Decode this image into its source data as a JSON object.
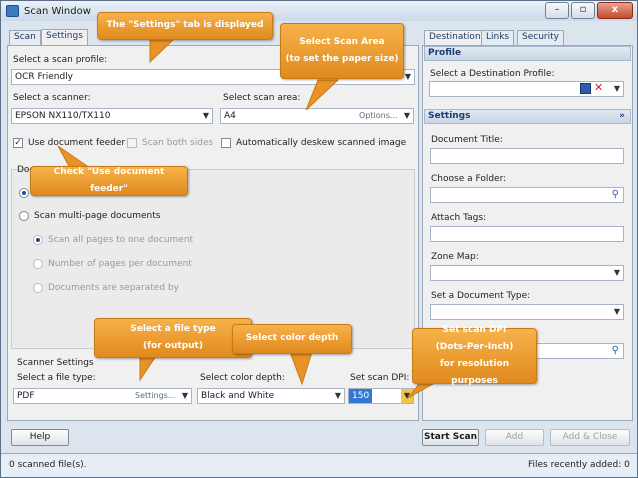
{
  "window": {
    "title": "Scan Window",
    "controls": {
      "minimize": "–",
      "maximize": "▫",
      "close": "x"
    }
  },
  "left_tabs": [
    {
      "label": "Scan"
    },
    {
      "label": "Settings"
    }
  ],
  "settings": {
    "scan_profile_label": "Select a scan profile:",
    "scan_profile_value": "OCR Friendly",
    "scanner_label": "Select a scanner:",
    "scanner_value": "EPSON NX110/TX110",
    "scan_area_label": "Select scan area:",
    "scan_area_value": "A4",
    "scan_area_options": "Options...",
    "use_feeder_label": "Use document feeder",
    "use_feeder_checked": true,
    "scan_both_sides_label": "Scan both sides",
    "deskew_label": "Automatically deskew scanned image",
    "doc_group_label": "Doc",
    "multi_page_label": "Scan multi-page documents",
    "all_pages_label": "Scan all pages to one document",
    "pages_per_doc_label": "Number of pages per document",
    "separated_by_label": "Documents are separated by",
    "scanner_settings_label": "Scanner Settings",
    "file_type_label": "Select a file type:",
    "file_type_value": "PDF",
    "file_type_settings": "Settings...",
    "color_depth_label": "Select color depth:",
    "color_depth_value": "Black and White",
    "dpi_label": "Set scan DPI:",
    "dpi_value": "150"
  },
  "right_tabs": [
    {
      "label": "Destination"
    },
    {
      "label": "Links"
    },
    {
      "label": "Security"
    }
  ],
  "destination": {
    "profile_header": "Profile",
    "dest_profile_label": "Select a Destination Profile:",
    "settings_header": "Settings",
    "collapse_glyph": "»",
    "doc_title_label": "Document Title:",
    "folder_label": "Choose a Folder:",
    "tags_label": "Attach Tags:",
    "zone_map_label": "Zone Map:",
    "doc_type_label": "Set a Document Type:"
  },
  "buttons": {
    "help": "Help",
    "start_scan": "Start Scan",
    "add": "Add",
    "add_close": "Add & Close"
  },
  "status": {
    "left": "0 scanned file(s).",
    "right": "Files recently added: 0"
  },
  "callouts": {
    "settings_tab": "The \"Settings\" tab is displayed",
    "scan_area": "Select Scan Area\n(to set the paper size)",
    "feeder": "Check \"Use document feeder\"",
    "file_type": "Select a file type\n(for output)",
    "color_depth": "Select color depth",
    "dpi": "Set scan DPI\n(Dots-Per-Inch)\nfor resolution purposes"
  },
  "colors": {
    "callout": "#f0a030",
    "accent": "#1f4d8f",
    "window_bg": "#dce4ee"
  }
}
